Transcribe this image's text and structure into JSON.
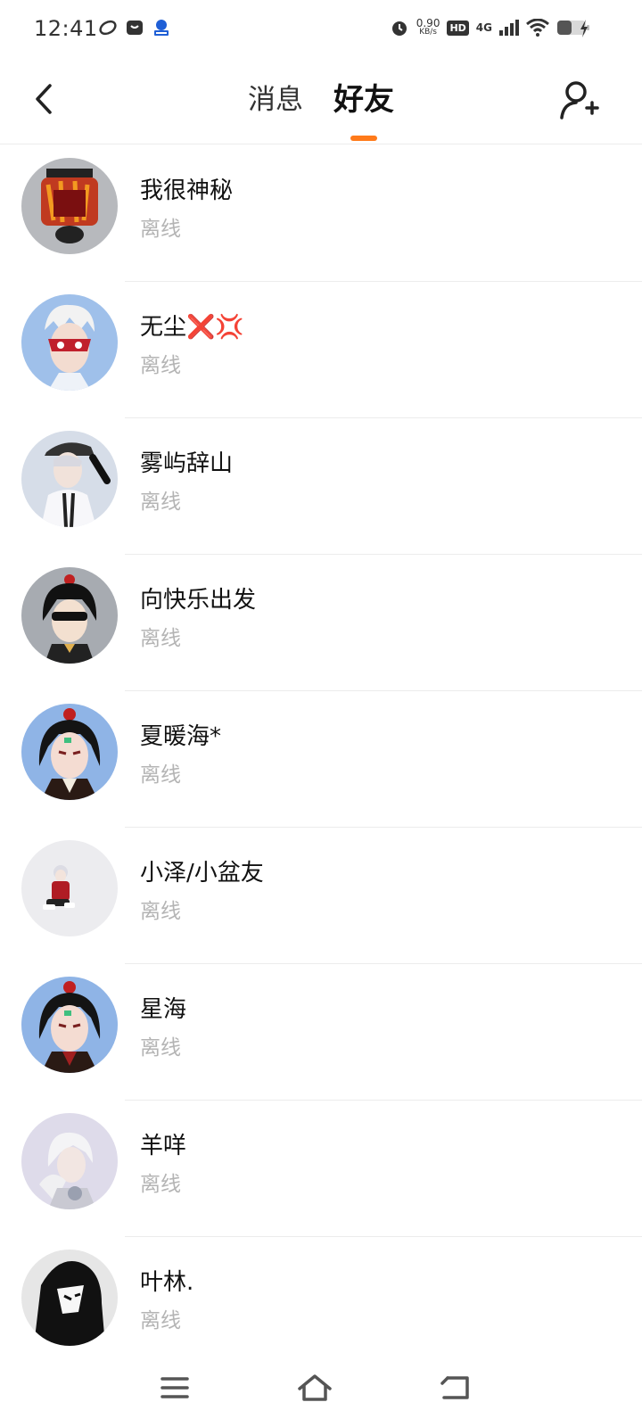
{
  "status_bar": {
    "time": "12:41",
    "net_speed_value": "0.90",
    "net_speed_unit": "KB/s",
    "hd": "HD",
    "network": "4G",
    "icons": [
      "app-leaf-icon",
      "app-chat-icon",
      "app-shield-icon",
      "alarm-icon",
      "signal-icon",
      "wifi-icon",
      "battery-icon",
      "charging-icon"
    ]
  },
  "header": {
    "tabs": [
      {
        "label": "消息",
        "active": false
      },
      {
        "label": "好友",
        "active": true
      }
    ],
    "accent_color": "#ff7a1a"
  },
  "friends": [
    {
      "name": "我很神秘",
      "status": "离线",
      "avatar_bg": "#b7b9bd"
    },
    {
      "name": "无尘❌💢",
      "status": "离线",
      "avatar_bg": "#9fc0ea"
    },
    {
      "name": "雾屿辞山",
      "status": "离线",
      "avatar_bg": "#d6dde8"
    },
    {
      "name": "向快乐出发",
      "status": "离线",
      "avatar_bg": "#a7abb1"
    },
    {
      "name": "夏暖海*",
      "status": "离线",
      "avatar_bg": "#8fb4e6"
    },
    {
      "name": "小泽/小盆友",
      "status": "离线",
      "avatar_bg": "#ececef"
    },
    {
      "name": "星海",
      "status": "离线",
      "avatar_bg": "#8fb4e6"
    },
    {
      "name": "羊咩",
      "status": "离线",
      "avatar_bg": "#dedbea"
    },
    {
      "name": "叶林.",
      "status": "离线",
      "avatar_bg": "#e6e6e6"
    }
  ]
}
